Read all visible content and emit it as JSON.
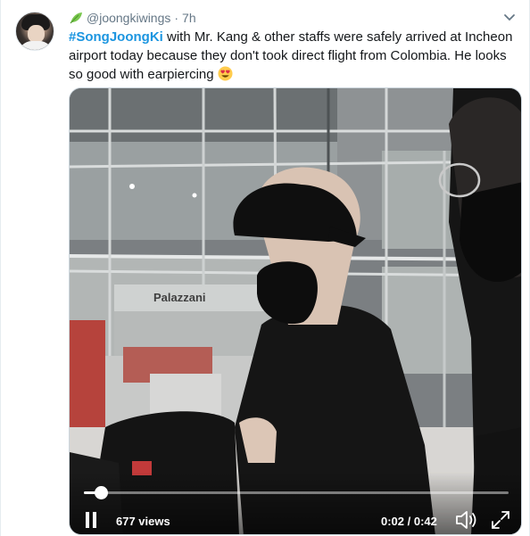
{
  "tweet": {
    "handle": "@joongkiwings",
    "separator": "·",
    "time": "7h",
    "hashtag": "#SongJoongKi",
    "body": " with Mr. Kang & other staffs were safely arrived at Incheon airport today because they don't took direct flight from Colombia. He looks so good with earpiercing "
  },
  "video": {
    "views": "677 views",
    "time": "0:02 / 0:42",
    "progress": 0.04,
    "sign_text": "Palazzani"
  },
  "icons": {
    "leaf": "leaf-icon",
    "caret": "chevron-down-icon",
    "emoji": "heart-eyes-emoji-icon",
    "play": "pause-icon",
    "volume": "volume-icon",
    "fullscreen": "fullscreen-icon"
  },
  "colors": {
    "hashtag": "#1b95e0",
    "secondary_text": "#657786",
    "leaf": "#7ac74f"
  }
}
